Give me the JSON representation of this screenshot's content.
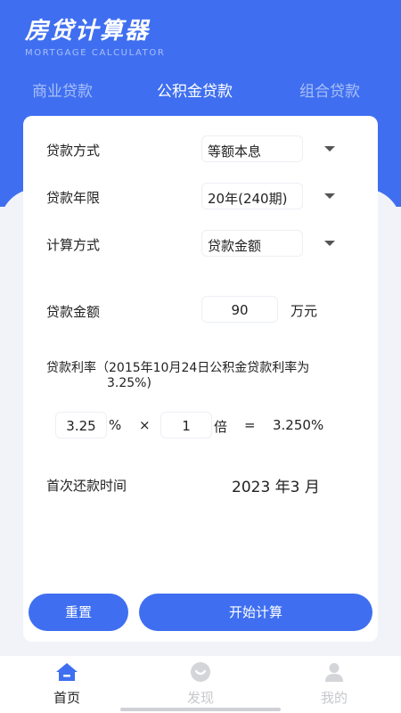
{
  "header": {
    "title": "房贷计算器",
    "subtitle": "MORTGAGE CALCULATOR"
  },
  "tabs": [
    {
      "label": "商业贷款",
      "active": false
    },
    {
      "label": "公积金贷款",
      "active": true
    },
    {
      "label": "组合贷款",
      "active": false
    }
  ],
  "form": {
    "repayment_method": {
      "label": "贷款方式",
      "value": "等额本息"
    },
    "loan_term": {
      "label": "贷款年限",
      "value": "20年(240期)"
    },
    "calc_method": {
      "label": "计算方式",
      "value": "贷款金额"
    },
    "loan_amount": {
      "label": "贷款金额",
      "value": "90",
      "unit": "万元"
    },
    "interest_rate": {
      "label": "贷款利率（2015年10月24日公积金贷款利率为",
      "note": "3.25%)",
      "base_rate": "3.25",
      "percent_sign": "%",
      "times_sign": "×",
      "multiplier": "1",
      "multiplier_unit": "倍",
      "equals_sign": "=",
      "result": "3.250%"
    },
    "first_payment": {
      "label": "首次还款时间",
      "value": "2023 年3 月"
    }
  },
  "actions": {
    "reset_label": "重置",
    "calculate_label": "开始计算"
  },
  "bottom_nav": [
    {
      "label": "首页",
      "icon": "home-icon",
      "active": true
    },
    {
      "label": "发现",
      "icon": "discover-icon",
      "active": false
    },
    {
      "label": "我的",
      "icon": "user-icon",
      "active": false
    }
  ],
  "colors": {
    "primary": "#3f6ff0",
    "background": "#f1f3f8",
    "inactive": "#c6c8cc"
  }
}
